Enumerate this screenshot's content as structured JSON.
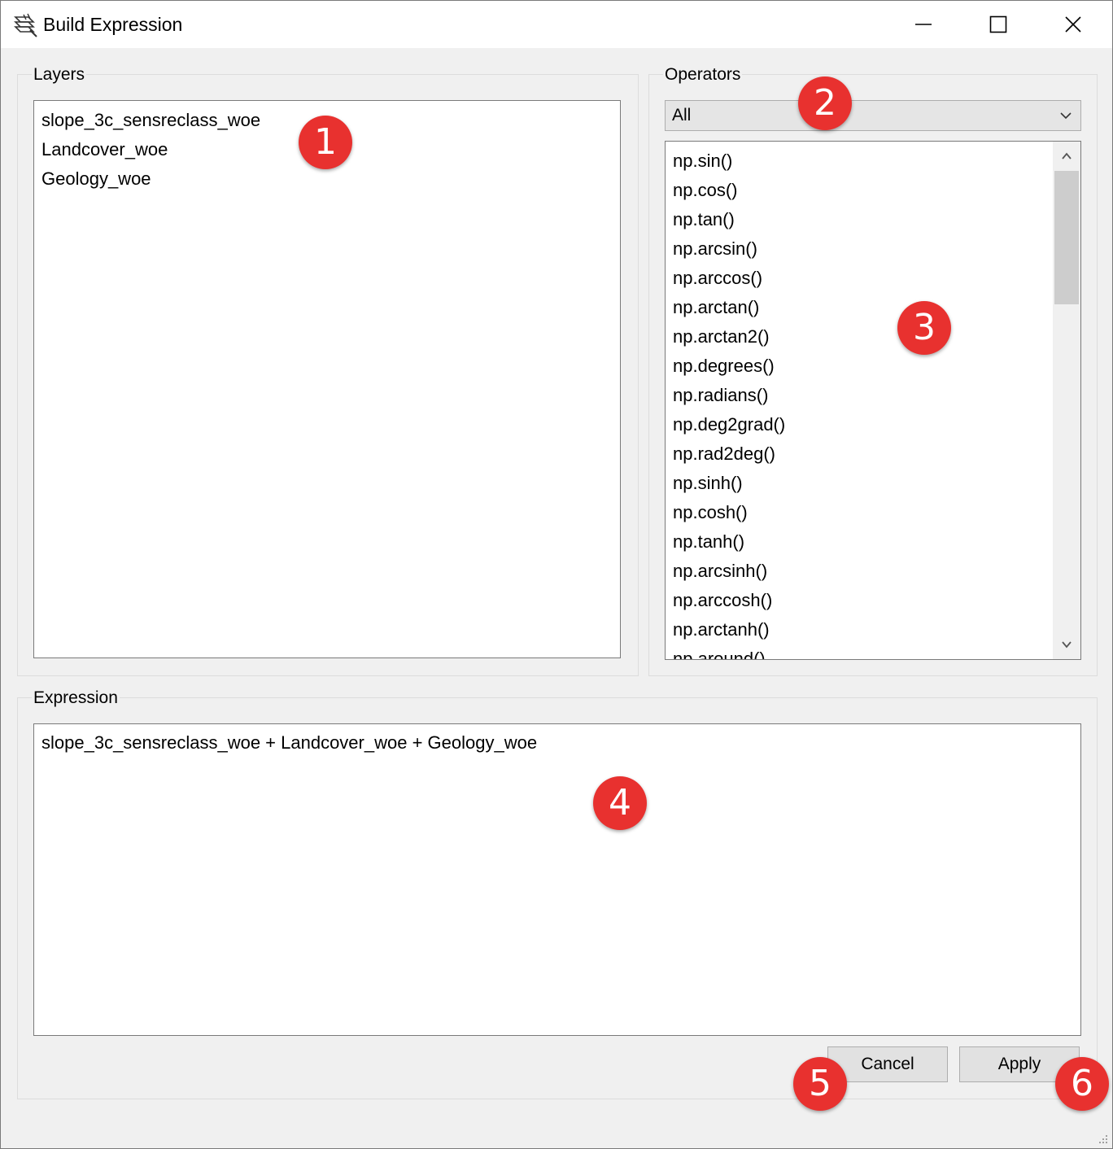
{
  "window": {
    "title": "Build Expression",
    "icon": "expression-builder-icon",
    "controls": [
      "minimize-icon",
      "maximize-icon",
      "close-icon"
    ]
  },
  "layers": {
    "group_label": "Layers",
    "items": [
      "slope_3c_sensreclass_woe",
      "Landcover_woe",
      "Geology_woe"
    ]
  },
  "operators": {
    "group_label": "Operators",
    "filter_value": "All",
    "items": [
      "np.sin()",
      "np.cos()",
      "np.tan()",
      "np.arcsin()",
      "np.arccos()",
      "np.arctan()",
      "np.arctan2()",
      "np.degrees()",
      "np.radians()",
      "np.deg2grad()",
      "np.rad2deg()",
      "np.sinh()",
      "np.cosh()",
      "np.tanh()",
      "np.arcsinh()",
      "np.arccosh()",
      "np.arctanh()",
      "np.around()"
    ]
  },
  "expression": {
    "group_label": "Expression",
    "value": "slope_3c_sensreclass_woe + Landcover_woe + Geology_woe"
  },
  "buttons": {
    "cancel": "Cancel",
    "apply": "Apply"
  },
  "badges": {
    "b1": "1",
    "b2": "2",
    "b3": "3",
    "b4": "4",
    "b5": "5",
    "b6": "6"
  },
  "colors": {
    "badge": "#e8312f",
    "background": "#f0f0f0",
    "titlebar": "#ffffff"
  }
}
